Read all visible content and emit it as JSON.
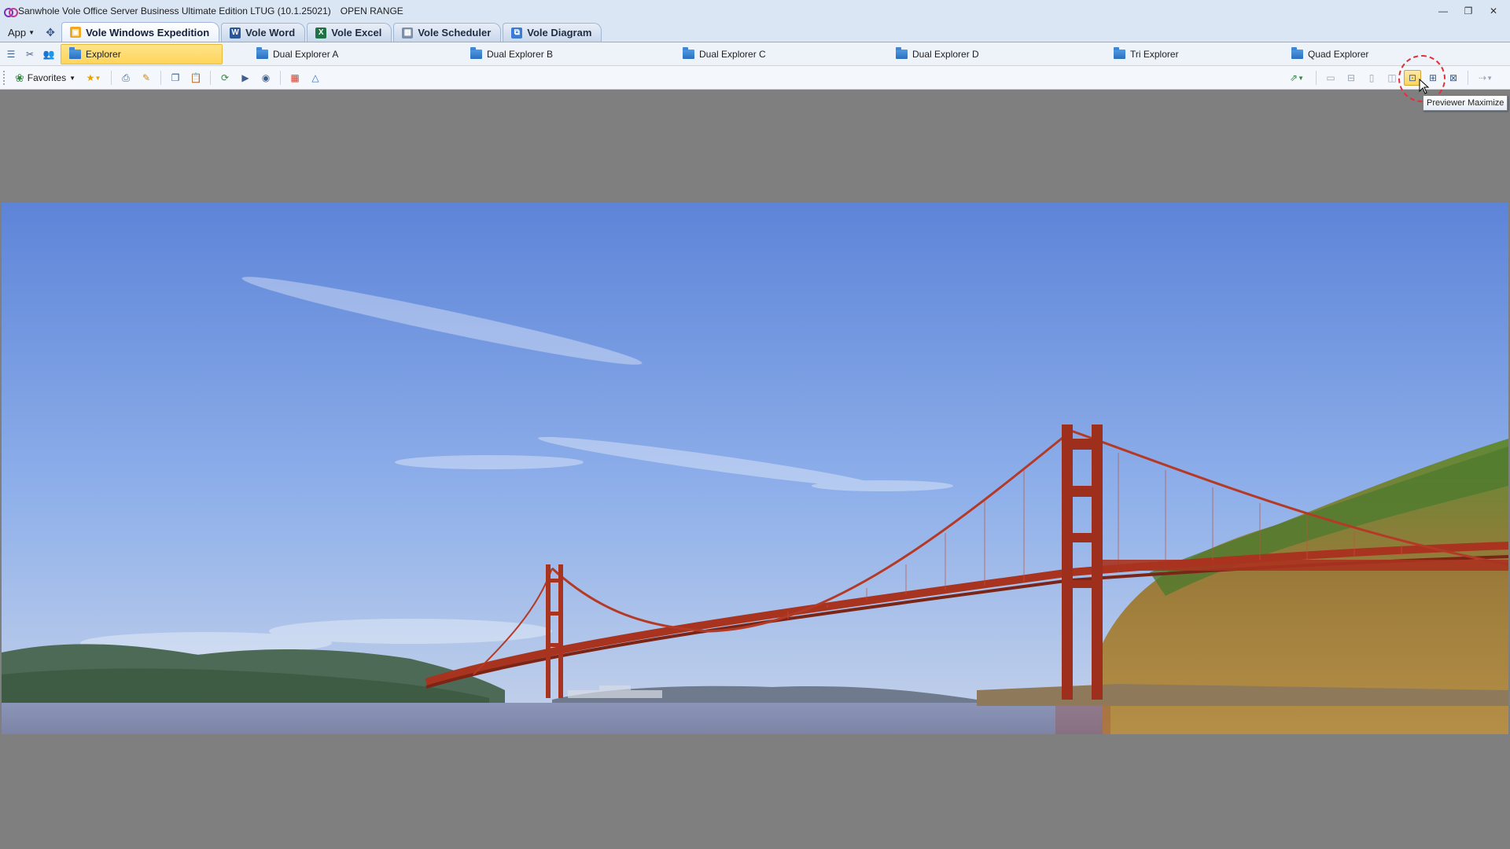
{
  "window": {
    "title": "Sanwhole Vole Office Server Business Ultimate Edition LTUG (10.1.25021)",
    "title_extra": "OPEN RANGE",
    "controls": {
      "minimize": "—",
      "restore": "❐",
      "close": "✕"
    }
  },
  "ribbon": {
    "app_menu": "App",
    "tabs": [
      {
        "label": "Vole Windows Expedition",
        "icon": "expedition-icon",
        "active": true
      },
      {
        "label": "Vole Word",
        "icon": "word-icon"
      },
      {
        "label": "Vole Excel",
        "icon": "excel-icon"
      },
      {
        "label": "Vole Scheduler",
        "icon": "scheduler-icon"
      },
      {
        "label": "Vole Diagram",
        "icon": "diagram-icon"
      }
    ]
  },
  "layouts": {
    "tabs": [
      {
        "label": "Explorer",
        "active": true
      },
      {
        "label": "Dual Explorer A"
      },
      {
        "label": "Dual Explorer B"
      },
      {
        "label": "Dual Explorer C"
      },
      {
        "label": "Dual Explorer D"
      },
      {
        "label": "Tri Explorer"
      },
      {
        "label": "Quad Explorer"
      }
    ]
  },
  "toolbar": {
    "favorites_label": "Favorites",
    "previewer_maximize_tooltip": "Previewer Maximize"
  },
  "preview": {
    "subject": "golden-gate-bridge-photo"
  },
  "colors": {
    "accent_tab": "#ffd55a",
    "preview_background": "#7f7f7f",
    "bridge": "#b53a26"
  }
}
